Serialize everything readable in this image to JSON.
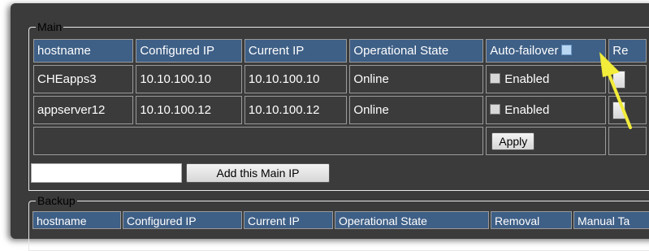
{
  "main": {
    "legend": "Main",
    "columns": [
      "hostname",
      "Configured IP",
      "Current IP",
      "Operational State",
      "Auto-failover",
      "Re"
    ],
    "rows": [
      {
        "hostname": "CHEapps3",
        "configured_ip": "10.10.100.10",
        "current_ip": "10.10.100.10",
        "state": "Online",
        "failover_label": "Enabled"
      },
      {
        "hostname": "appserver12",
        "configured_ip": "10.10.100.12",
        "current_ip": "10.10.100.12",
        "state": "Online",
        "failover_label": "Enabled"
      }
    ],
    "apply_label": "Apply",
    "ip_input_value": "",
    "add_button_label": "Add this Main IP"
  },
  "backup": {
    "legend": "Backup",
    "columns": [
      "hostname",
      "Configured IP",
      "Current IP",
      "Operational State",
      "Removal",
      "Manual Ta"
    ]
  },
  "colors": {
    "header_bg": "#3e5f86",
    "panel_bg": "#3b3b3b",
    "arrow": "#f2ec3a"
  },
  "icons": [
    "checkbox-icon",
    "callout-arrow-icon"
  ]
}
